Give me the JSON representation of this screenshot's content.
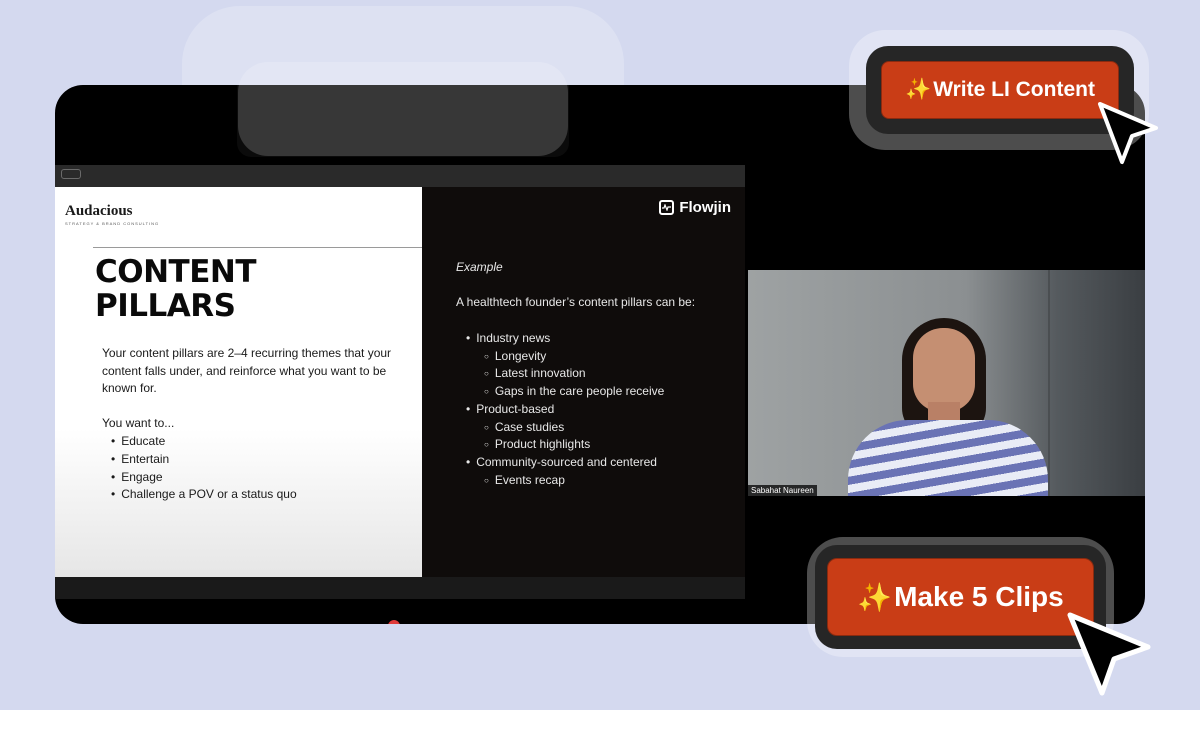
{
  "slide": {
    "left": {
      "brand": "Audacious",
      "brand_sub": "STRATEGY & BRAND CONSULTING",
      "title_line1": "CONTENT",
      "title_line2": "PILLARS",
      "body": "Your content pillars are 2–4 recurring themes that your content falls under, and reinforce what you want to be known for.",
      "want_label": "You want to...",
      "want_items": [
        "Educate",
        "Entertain",
        "Engage",
        "Challenge a POV or a status quo"
      ]
    },
    "right": {
      "logo": "Flowjin",
      "example_label": "Example",
      "lead": "A healthtech founder’s content pillars can be:",
      "pillars": [
        {
          "label": "Industry news",
          "subs": [
            "Longevity",
            "Latest innovation",
            "Gaps in the care people receive"
          ]
        },
        {
          "label": "Product-based",
          "subs": [
            "Case studies",
            "Product highlights"
          ]
        },
        {
          "label": "Community-sourced and centered",
          "subs": [
            "Events recap"
          ]
        }
      ]
    }
  },
  "webcam": {
    "participant_name": "Sabahat Naureen"
  },
  "cta": {
    "top_label": "Write LI Content",
    "bottom_label": "Make 5 Clips",
    "sparkle": "✨"
  },
  "colors": {
    "accent": "#c93d16",
    "background": "#d4d9ef",
    "frame": "#000000"
  },
  "icons": {
    "logo": "flowjin-logo-icon",
    "cursor": "arrow-cursor-icon"
  }
}
